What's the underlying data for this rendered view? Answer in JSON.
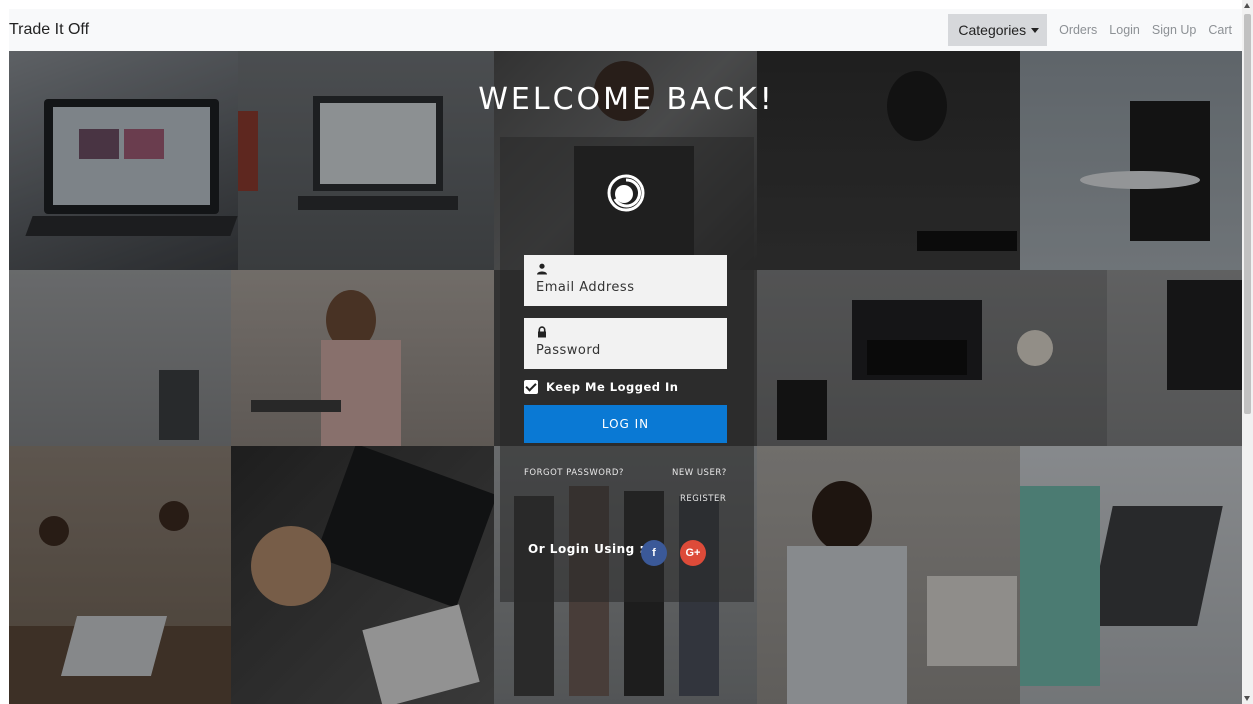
{
  "navbar": {
    "brand": "Trade It Off",
    "categories_label": "Categories",
    "links": [
      "Orders",
      "Login",
      "Sign Up",
      "Cart"
    ]
  },
  "login": {
    "title": "WELCOME BACK!",
    "email_placeholder": "Email Address",
    "password_placeholder": "Password",
    "keep_logged_in": "Keep Me Logged In",
    "keep_logged_in_checked": true,
    "submit_label": "LOG IN",
    "forgot_password": "FORGOT PASSWORD?",
    "new_user": "NEW USER?",
    "register": "REGISTER",
    "social_label": "Or Login Using :",
    "facebook_glyph": "f",
    "google_glyph": "G+"
  },
  "colors": {
    "navbar_bg": "#f8f9fa",
    "primary_button": "#0a79d4",
    "facebook": "#3b5998",
    "google": "#dd4b39"
  },
  "icons": {
    "logo": "spiral-logo-icon",
    "email_field": "user-icon",
    "password_field": "lock-icon",
    "categories": "caret-down-icon"
  }
}
